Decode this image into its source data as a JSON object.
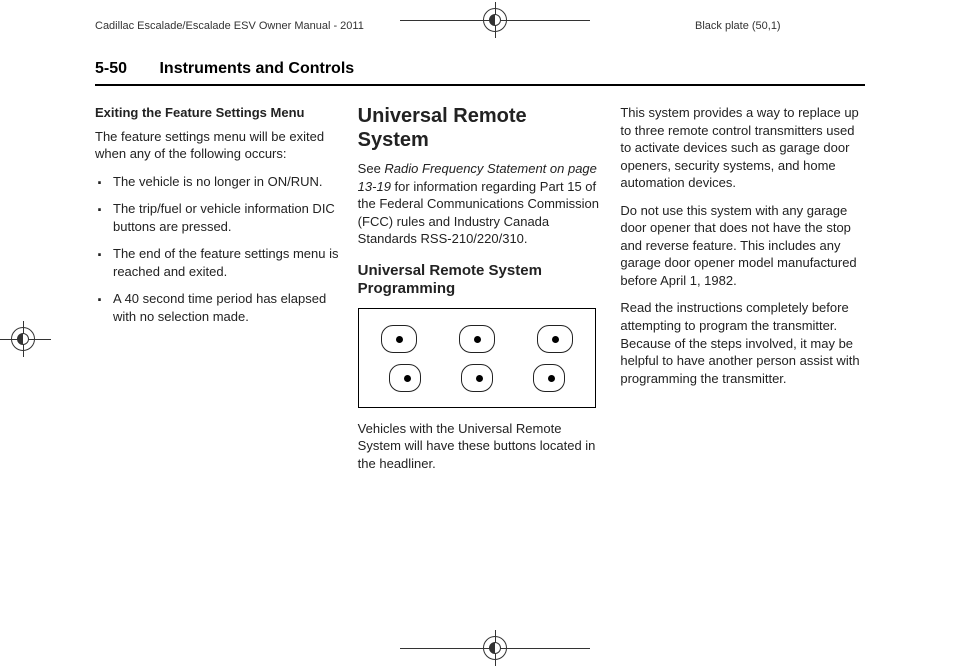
{
  "meta": {
    "doc_title": "Cadillac Escalade/Escalade ESV Owner Manual - 2011",
    "plate": "Black plate (50,1)"
  },
  "header": {
    "page_number": "5-50",
    "section": "Instruments and Controls"
  },
  "col1": {
    "heading": "Exiting the Feature Settings Menu",
    "intro": "The feature settings menu will be exited when any of the following occurs:",
    "items": [
      "The vehicle is no longer in ON/RUN.",
      "The trip/fuel or vehicle information DIC buttons are pressed.",
      "The end of the feature settings menu is reached and exited.",
      "A 40 second time period has elapsed with no selection made."
    ]
  },
  "col2": {
    "h1": "Universal Remote System",
    "p1a": "See ",
    "p1_italic": "Radio Frequency Statement on page 13‑19",
    "p1b": " for information regarding Part 15 of the Federal Communications Commission (FCC) rules and Industry Canada Standards RSS-210/220/310.",
    "h2": "Universal Remote System Programming",
    "caption": "Vehicles with the Universal Remote System will have these buttons located in the headliner."
  },
  "col3": {
    "p1": "This system provides a way to replace up to three remote control transmitters used to activate devices such as garage door openers, security systems, and home automation devices.",
    "p2": "Do not use this system with any garage door opener that does not have the stop and reverse feature. This includes any garage door opener model manufactured before April 1, 1982.",
    "p3": "Read the instructions completely before attempting to program the transmitter. Because of the steps involved, it may be helpful to have another person assist with programming the transmitter."
  }
}
